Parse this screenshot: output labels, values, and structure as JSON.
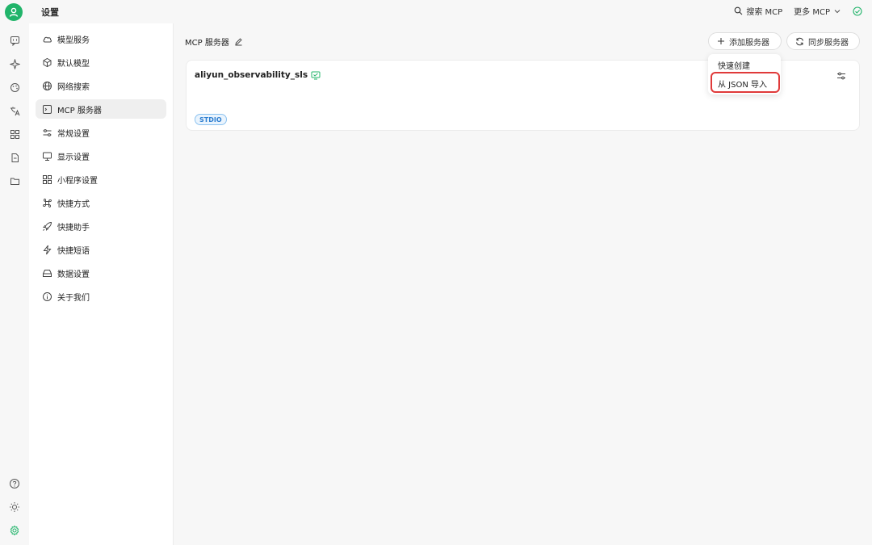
{
  "app": {
    "title": "设置"
  },
  "topbar": {
    "search_mcp": "搜索 MCP",
    "more_mcp": "更多 MCP"
  },
  "sidebar": {
    "items": [
      {
        "label": "模型服务",
        "icon": "cloud-icon"
      },
      {
        "label": "默认模型",
        "icon": "cube-icon"
      },
      {
        "label": "网络搜索",
        "icon": "globe-icon"
      },
      {
        "label": "MCP 服务器",
        "icon": "terminal-icon",
        "active": true
      },
      {
        "label": "常规设置",
        "icon": "sliders-icon"
      },
      {
        "label": "显示设置",
        "icon": "monitor-icon"
      },
      {
        "label": "小程序设置",
        "icon": "grid-icon"
      },
      {
        "label": "快捷方式",
        "icon": "command-icon"
      },
      {
        "label": "快捷助手",
        "icon": "rocket-icon"
      },
      {
        "label": "快捷短语",
        "icon": "bolt-icon"
      },
      {
        "label": "数据设置",
        "icon": "drive-icon"
      },
      {
        "label": "关于我们",
        "icon": "info-icon"
      }
    ]
  },
  "main": {
    "header": "MCP 服务器",
    "add_server": "添加服务器",
    "sync_server": "同步服务器",
    "server": {
      "name": "aliyun_observability_sls",
      "tag": "STDIO"
    },
    "dropdown": {
      "quick_create": "快速创建",
      "import_json": "从 JSON 导入"
    }
  },
  "colors": {
    "accent": "#21b46a",
    "highlight": "#e03a3a",
    "tag": "#2e7fd1"
  }
}
